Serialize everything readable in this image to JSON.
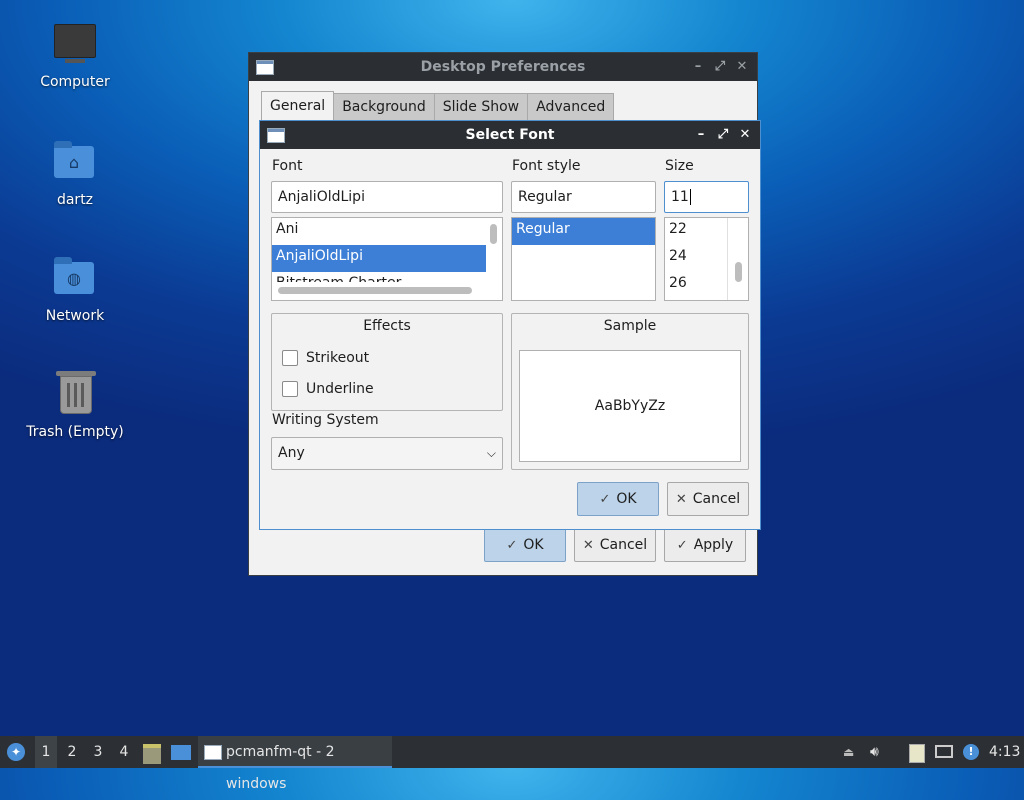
{
  "desktop": {
    "icons": [
      {
        "label": "Computer",
        "icon": "computer-icon"
      },
      {
        "label": "dartz",
        "icon": "home-folder-icon"
      },
      {
        "label": "Network",
        "icon": "network-folder-icon"
      },
      {
        "label": "Trash (Empty)",
        "icon": "trash-icon"
      }
    ]
  },
  "prefs_window": {
    "title": "Desktop Preferences",
    "tabs": [
      "General",
      "Background",
      "Slide Show",
      "Advanced"
    ],
    "selected_tab": "General",
    "buttons": {
      "ok": "OK",
      "cancel": "Cancel",
      "apply": "Apply"
    }
  },
  "font_dialog": {
    "title": "Select Font",
    "font_label": "Font",
    "font_value": "AnjaliOldLipi",
    "font_list": [
      "Ani",
      "AnjaliOldLipi",
      "Bitstream Charter"
    ],
    "font_selected": "AnjaliOldLipi",
    "style_label": "Font style",
    "style_value": "Regular",
    "style_list": [
      "Regular"
    ],
    "size_label": "Size",
    "size_value": "11",
    "size_list": [
      "22",
      "24",
      "26"
    ],
    "effects_title": "Effects",
    "strikeout_label": "Strikeout",
    "underline_label": "Underline",
    "writing_system_label": "Writing System",
    "writing_system_value": "Any",
    "sample_title": "Sample",
    "sample_text": "AaBbYyZz",
    "ok_label": "OK",
    "cancel_label": "Cancel"
  },
  "taskbar": {
    "workspaces": [
      "1",
      "2",
      "3",
      "4"
    ],
    "active_workspace": "1",
    "task_label": "pcmanfm-qt - 2 windows",
    "clock": "4:13"
  },
  "colors": {
    "selection": "#3d7fd6",
    "titlebar": "#2b2f33",
    "primary_button": "#bcd3ea"
  }
}
